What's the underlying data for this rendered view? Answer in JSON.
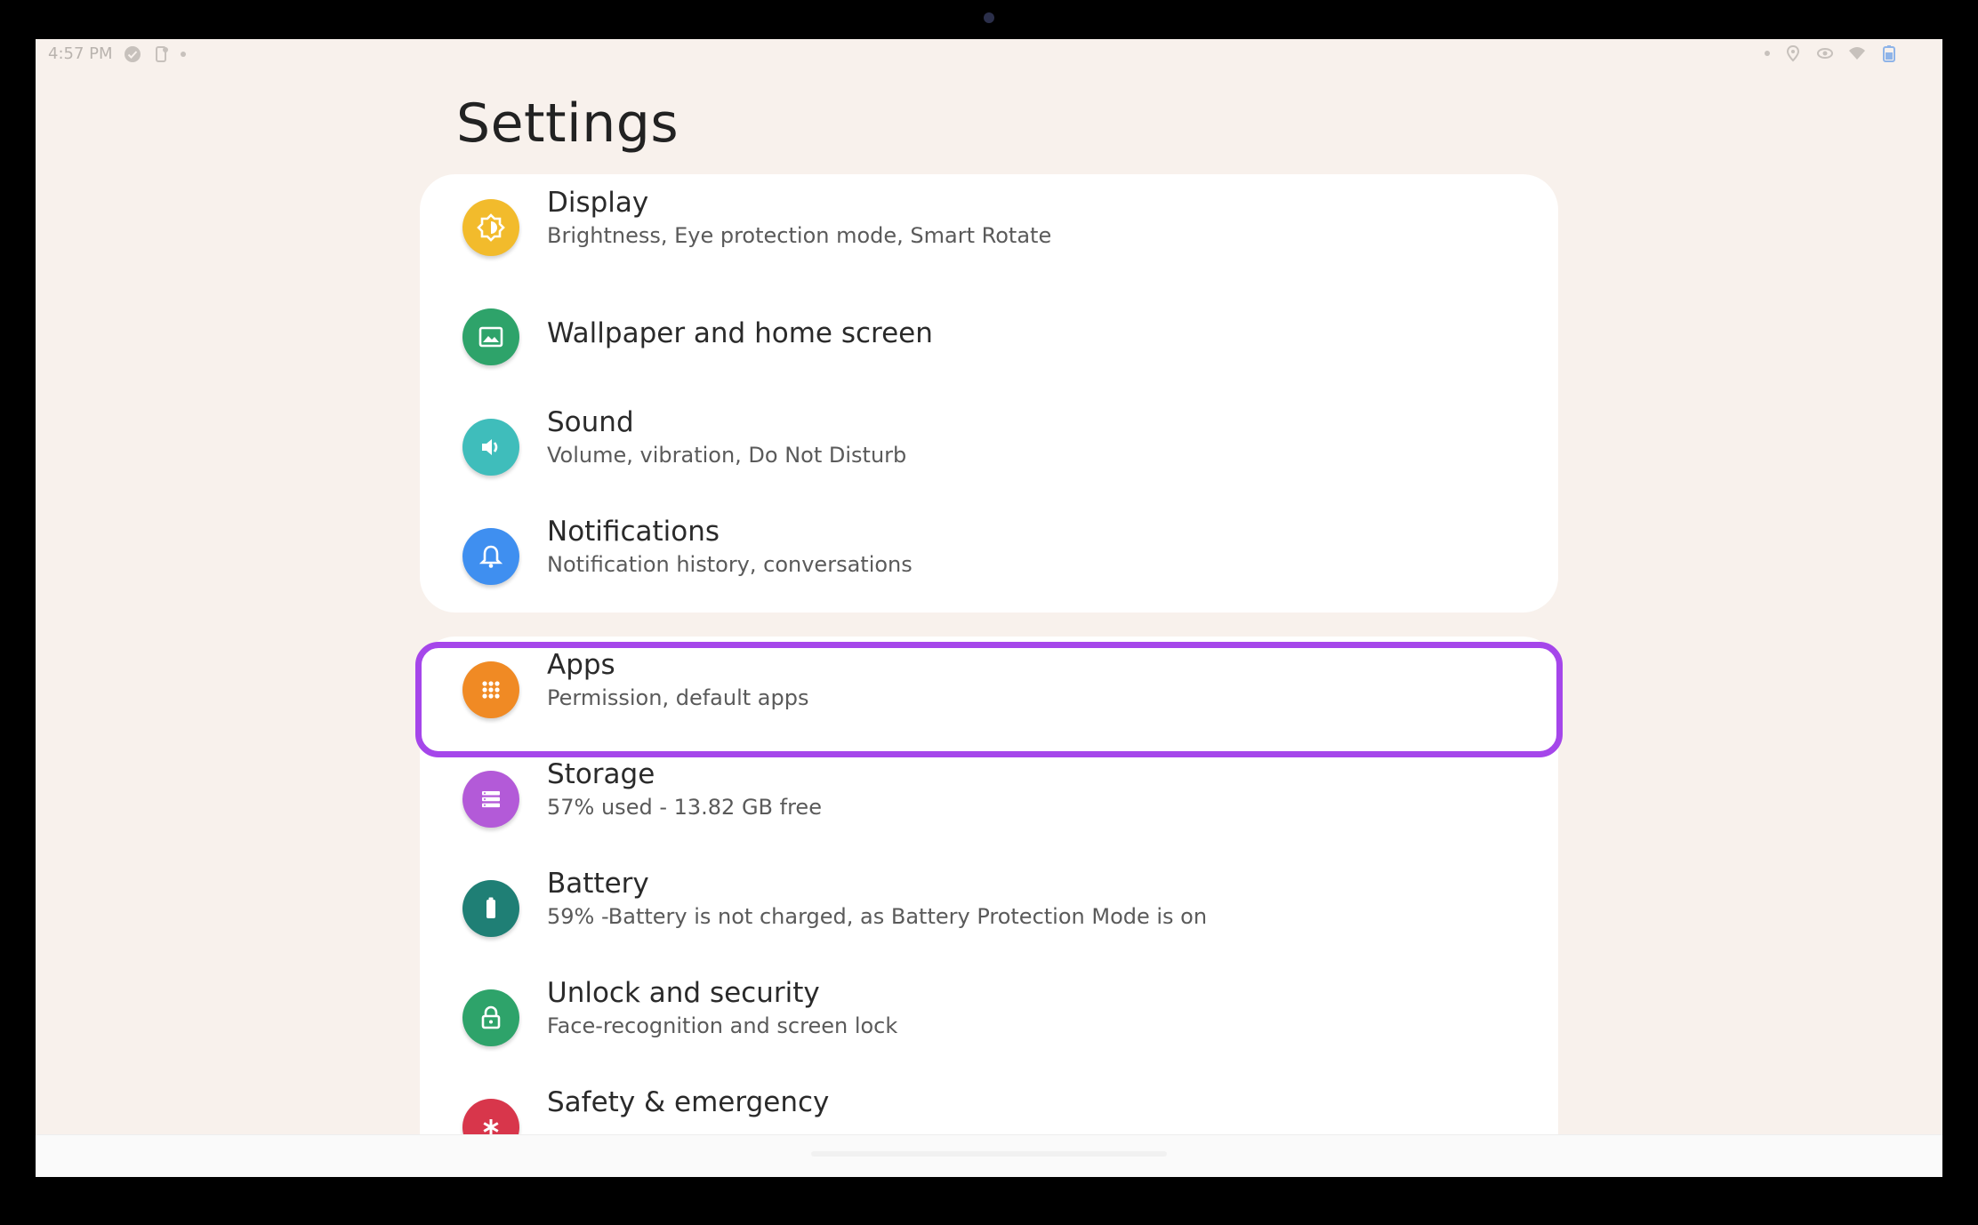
{
  "status_bar": {
    "time": "4:57 PM"
  },
  "page": {
    "title": "Settings"
  },
  "colors": {
    "display": "#f2bb2c",
    "wallpaper": "#2ea36a",
    "sound": "#3fbdbb",
    "notifications": "#3f8ff0",
    "apps": "#f08a24",
    "storage": "#b35ad8",
    "battery": "#1f7f75",
    "security": "#2ea36a",
    "safety": "#d8364b",
    "highlight": "#a546ea"
  },
  "settings": {
    "display": {
      "title": "Display",
      "subtitle": "Brightness, Eye protection mode, Smart Rotate",
      "icon": "display-icon"
    },
    "wallpaper": {
      "title": "Wallpaper and home screen",
      "icon": "wallpaper-icon"
    },
    "sound": {
      "title": "Sound",
      "subtitle": "Volume, vibration, Do Not Disturb",
      "icon": "speaker-icon"
    },
    "notifications": {
      "title": "Notifications",
      "subtitle": "Notification history, conversations",
      "icon": "bell-icon"
    },
    "apps": {
      "title": "Apps",
      "subtitle": "Permission, default apps",
      "icon": "apps-grid-icon"
    },
    "storage": {
      "title": "Storage",
      "subtitle": "57% used - 13.82 GB free",
      "icon": "storage-icon"
    },
    "battery": {
      "title": "Battery",
      "subtitle": "59% -Battery is not charged, as Battery Protection Mode is on",
      "icon": "battery-icon"
    },
    "security": {
      "title": "Unlock and security",
      "subtitle": "Face-recognition and screen lock",
      "icon": "lock-icon"
    },
    "safety": {
      "title": "Safety & emergency",
      "icon": "emergency-icon"
    }
  }
}
